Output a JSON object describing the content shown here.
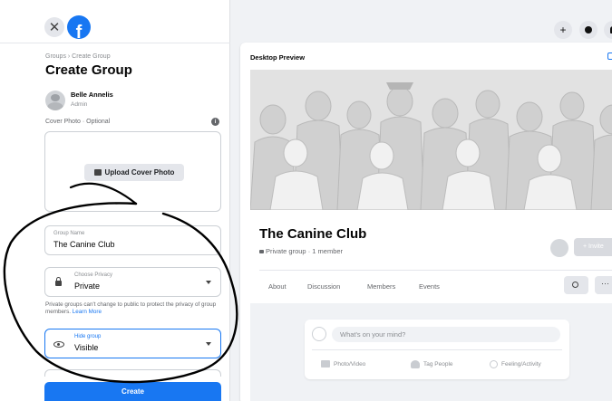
{
  "left_panel": {
    "close_glyph": "✕",
    "logo_letter": "f",
    "breadcrumb": "Groups › Create Group",
    "title": "Create Group",
    "user": {
      "name": "Belle Annelis",
      "role": "Admin"
    },
    "cover_photo": {
      "label": "Cover Photo · Optional",
      "info_glyph": "i",
      "upload_label": "Upload Cover Photo"
    },
    "group_name_field": {
      "label": "Group Name",
      "value": "The Canine Club"
    },
    "privacy_field": {
      "label": "Choose Privacy",
      "value": "Private"
    },
    "privacy_note": "Private groups can't change to public to protect the privacy of group members.",
    "privacy_learn_more": "Learn More",
    "hide_group_field": {
      "label": "Hide group",
      "value": "Visible"
    },
    "create_button": "Create"
  },
  "top_icons": [
    "plus-icon",
    "messenger-icon",
    "bell-icon"
  ],
  "plus_glyph": "+",
  "preview": {
    "title": "Desktop Preview",
    "group_name": "The Canine Club",
    "group_meta": "Private group · 1 member",
    "invite_label": "+ Invite",
    "tabs": [
      "About",
      "Discussion",
      "Members",
      "Events"
    ],
    "more_glyph": "···",
    "composer": {
      "placeholder": "What's on your mind?",
      "actions": [
        "Photo/Video",
        "Tag People",
        "Feeling/Activity"
      ]
    }
  },
  "colors": {
    "accent": "#1877f2",
    "background": "#f0f2f5",
    "annotation_ink": "#000000"
  },
  "icons": [
    "close-icon",
    "facebook-logo-icon",
    "info-icon",
    "photo-icon",
    "lock-icon",
    "eye-icon",
    "chevron-down-icon",
    "search-icon",
    "more-icon"
  ]
}
